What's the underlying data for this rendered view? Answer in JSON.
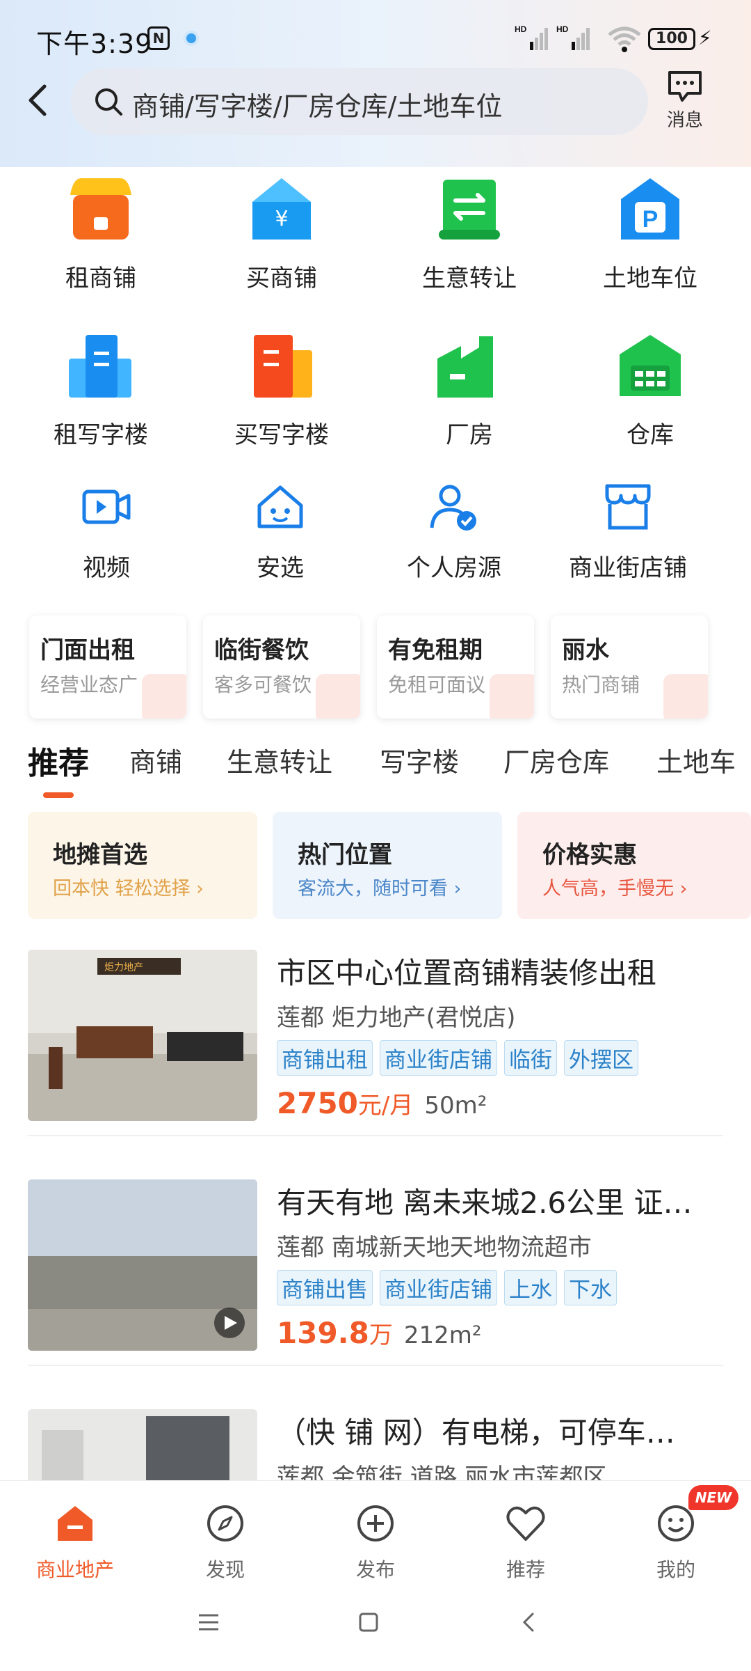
{
  "status_bar": {
    "time": "下午3:39",
    "nfc": "N",
    "battery": "100",
    "signal1": "HD",
    "signal2": "HD"
  },
  "search": {
    "placeholder": "商铺/写字楼/厂房仓库/土地车位"
  },
  "header": {
    "message_label": "消息"
  },
  "categories_row1": [
    {
      "label": "租商铺",
      "icon": "shop-icon",
      "color": "#f66a1e"
    },
    {
      "label": "买商铺",
      "icon": "yuan-house-icon",
      "color": "#1a9bf2"
    },
    {
      "label": "生意转让",
      "icon": "transfer-scroll-icon",
      "color": "#20c24e"
    },
    {
      "label": "土地车位",
      "icon": "parking-icon",
      "color": "#1a8ef0"
    }
  ],
  "categories_row2": [
    {
      "label": "租写字楼",
      "icon": "office-building-icon",
      "color": "#1a8ef0"
    },
    {
      "label": "买写字楼",
      "icon": "office-building-orange-icon",
      "color": "#f66a1e"
    },
    {
      "label": "厂房",
      "icon": "factory-icon",
      "color": "#20c24e"
    },
    {
      "label": "仓库",
      "icon": "warehouse-icon",
      "color": "#20c24e"
    }
  ],
  "categories_row3": [
    {
      "label": "视频",
      "icon": "video-icon"
    },
    {
      "label": "安选",
      "icon": "safe-home-icon"
    },
    {
      "label": "个人房源",
      "icon": "verified-person-icon"
    },
    {
      "label": "商业街店铺",
      "icon": "storefront-icon"
    }
  ],
  "promos": [
    {
      "title": "门面出租",
      "subtitle": "经营业态广"
    },
    {
      "title": "临街餐饮",
      "subtitle": "客多可餐饮"
    },
    {
      "title": "有免租期",
      "subtitle": "免租可面议"
    },
    {
      "title": "丽水",
      "subtitle": "热门商铺"
    }
  ],
  "tabs": [
    "推荐",
    "商铺",
    "生意转让",
    "写字楼",
    "厂房仓库",
    "土地车"
  ],
  "filter_cards": [
    {
      "title": "地摊首选",
      "subtitle": "回本快 轻松选择 ›",
      "bg": "#fdf5e8",
      "sub_color": "#e1a24a"
    },
    {
      "title": "热门位置",
      "subtitle": "客流大，随时可看 ›",
      "bg": "#eef4fc",
      "sub_color": "#4a86c8"
    },
    {
      "title": "价格实惠",
      "subtitle": "人气高，手慢无 ›",
      "bg": "#fdeeed",
      "sub_color": "#e8553f"
    }
  ],
  "listings": [
    {
      "title": "市区中心位置商铺精装修出租",
      "location": "莲都 炬力地产(君悦店)",
      "tags": [
        "商铺出租",
        "商业街店铺",
        "临街",
        "外摆区"
      ],
      "price": "2750",
      "price_unit": "元/月",
      "area": "50m²",
      "sign_text": "炬力地产"
    },
    {
      "title": "有天有地 离未来城2.6公里 证…",
      "location": "莲都 南城新天地天地物流超市",
      "tags": [
        "商铺出售",
        "商业街店铺",
        "上水",
        "下水"
      ],
      "price": "139.8",
      "price_unit": "万",
      "area": "212m²"
    },
    {
      "title": "（快 铺 网）有电梯，可停车…",
      "location": "莲都 金筑街 道路 丽水市莲都区",
      "tags": [],
      "price": "",
      "price_unit": "",
      "area": ""
    }
  ],
  "bottom_nav": [
    {
      "label": "商业地产",
      "icon": "house-icon",
      "active": true
    },
    {
      "label": "发现",
      "icon": "compass-icon",
      "active": false
    },
    {
      "label": "发布",
      "icon": "plus-circle-icon",
      "active": false
    },
    {
      "label": "推荐",
      "icon": "heart-icon",
      "active": false
    },
    {
      "label": "我的",
      "icon": "smiley-icon",
      "active": false
    }
  ],
  "new_badge": "NEW",
  "accent_color": "#f05a28"
}
